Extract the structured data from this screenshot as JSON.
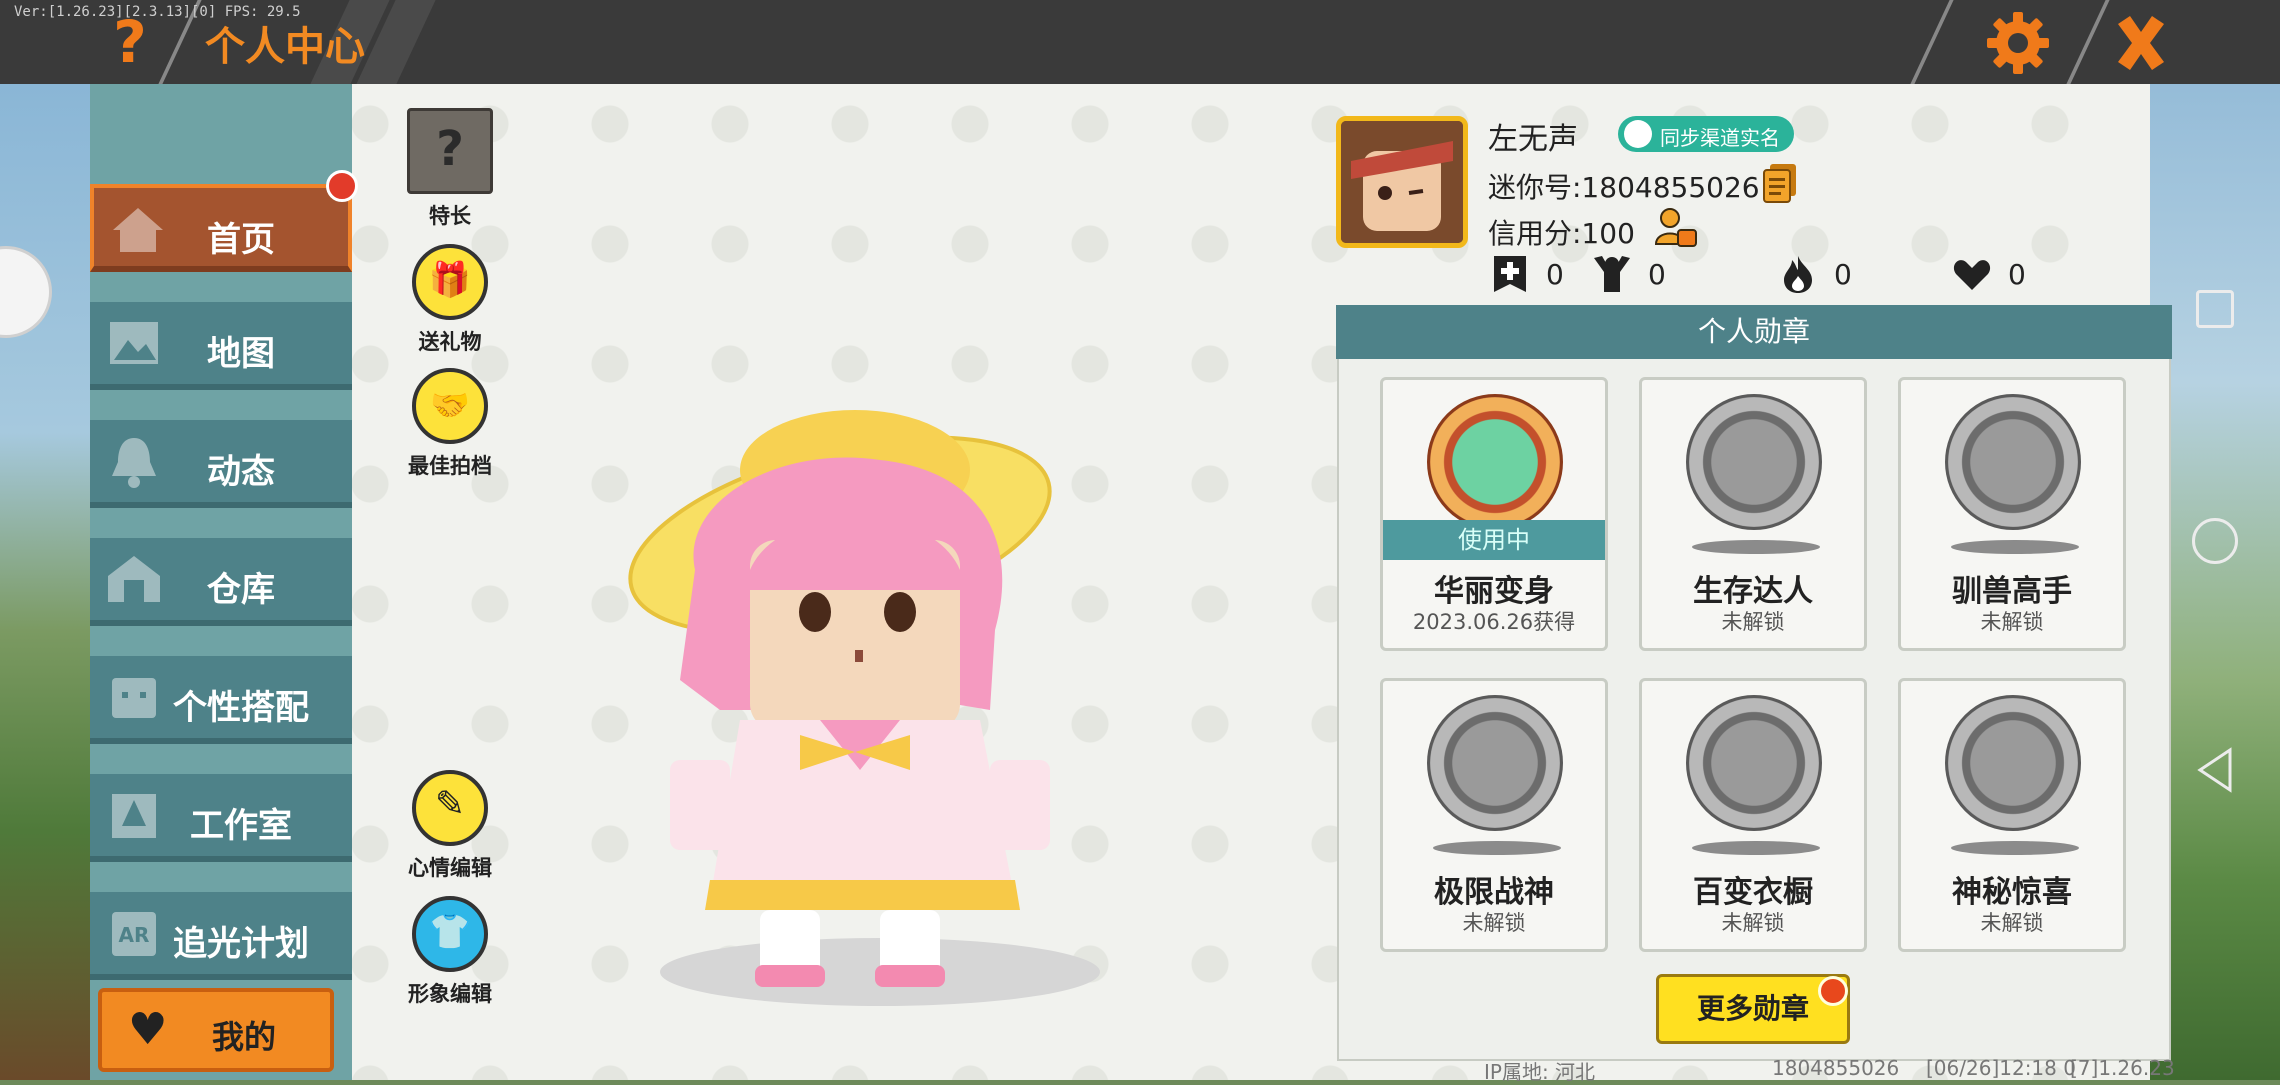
{
  "status_bar": {
    "version": "Ver:[1.26.23][2.3.13][0] FPS: 29.5"
  },
  "header": {
    "title": "个人中心",
    "help_icon": "question-icon",
    "settings_icon": "gear-icon",
    "close_icon": "close-icon"
  },
  "sidebar": {
    "items": [
      {
        "label": "首页",
        "icon": "home-icon",
        "active": true
      },
      {
        "label": "地图",
        "icon": "map-icon"
      },
      {
        "label": "动态",
        "icon": "bell-icon"
      },
      {
        "label": "仓库",
        "icon": "warehouse-icon"
      },
      {
        "label": "个性搭配",
        "icon": "outfit-icon"
      },
      {
        "label": "工作室",
        "icon": "studio-icon"
      },
      {
        "label": "追光计划",
        "icon": "spotlight-icon"
      }
    ],
    "mine_label": "我的"
  },
  "tools": {
    "skill": "特长",
    "gift": "送礼物",
    "partner": "最佳拍档",
    "mood": "心情编辑",
    "appearance": "形象编辑"
  },
  "profile": {
    "name": "左无声",
    "sync_label": "同步渠道实名",
    "mini_id": "迷你号:1804855026",
    "credit": "信用分:100",
    "stats": {
      "add_friend": "0",
      "fans": "0",
      "popularity": "0",
      "likes": "0"
    }
  },
  "medals": {
    "header": "个人勋章",
    "items": [
      {
        "name": "华丽变身",
        "status": "2023.06.26获得",
        "in_use_label": "使用中"
      },
      {
        "name": "生存达人",
        "status": "未解锁"
      },
      {
        "name": "驯兽高手",
        "status": "未解锁"
      },
      {
        "name": "极限战神",
        "status": "未解锁"
      },
      {
        "name": "百变衣橱",
        "status": "未解锁"
      },
      {
        "name": "神秘惊喜",
        "status": "未解锁"
      }
    ],
    "more_label": "更多勋章"
  },
  "footer": {
    "ip": "IP属地: 河北",
    "uid": "1804855026",
    "time": "[06/26]12:18 0",
    "ver": "[7]1.26.23"
  },
  "colors": {
    "accent": "#f28a22",
    "teal": "#4e8289",
    "title_bar": "#3a3a3a",
    "badge": "#2bb39a"
  }
}
